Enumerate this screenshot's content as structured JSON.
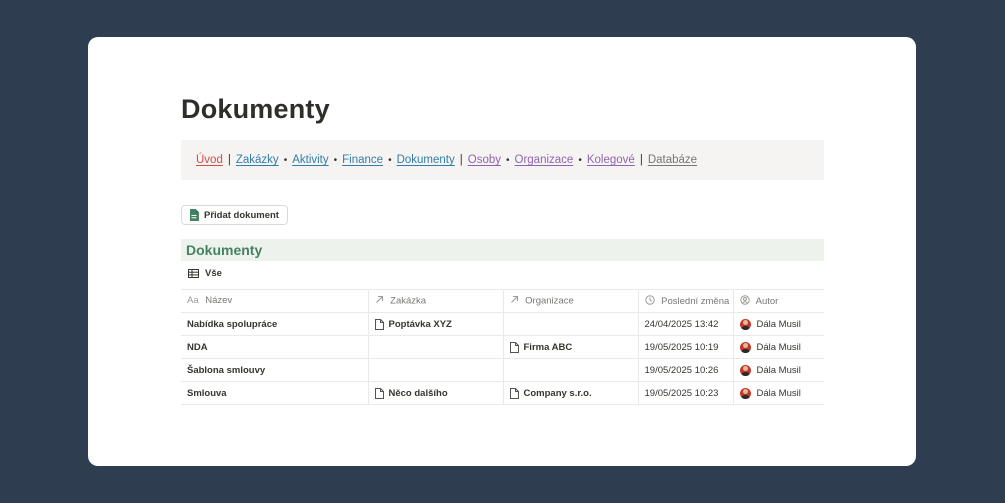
{
  "page": {
    "title": "Dokumenty"
  },
  "nav": {
    "items": [
      {
        "label": "Úvod",
        "color": "#d44c47"
      },
      {
        "sep": "|"
      },
      {
        "label": "Zakázky",
        "color": "#337ea9"
      },
      {
        "sep": "•"
      },
      {
        "label": "Aktivity",
        "color": "#337ea9"
      },
      {
        "sep": "•"
      },
      {
        "label": "Finance",
        "color": "#337ea9"
      },
      {
        "sep": "•"
      },
      {
        "label": "Dokumenty",
        "color": "#337ea9"
      },
      {
        "sep": "|"
      },
      {
        "label": "Osoby",
        "color": "#9065b0"
      },
      {
        "sep": "•"
      },
      {
        "label": "Organizace",
        "color": "#9065b0"
      },
      {
        "sep": "•"
      },
      {
        "label": "Kolegové",
        "color": "#9065b0"
      },
      {
        "sep": "|"
      },
      {
        "label": "Databáze",
        "color": "#787774"
      }
    ]
  },
  "actions": {
    "add_document_label": "Přidat dokument"
  },
  "database": {
    "title": "Dokumenty",
    "view_label": "Vše",
    "columns": [
      {
        "label": "Název",
        "icon": "text-icon",
        "glyph": "Aa"
      },
      {
        "label": "Zakázka",
        "icon": "relation-arrow-icon"
      },
      {
        "label": "Organizace",
        "icon": "relation-arrow-icon"
      },
      {
        "label": "Poslední změna",
        "icon": "clock-icon"
      },
      {
        "label": "Autor",
        "icon": "person-icon"
      }
    ],
    "rows": [
      {
        "name": "Nabídka spolupráce",
        "zakazka": "Poptávka XYZ",
        "organizace": "",
        "modified": "24/04/2025 13:42",
        "author": "Dála Musil"
      },
      {
        "name": "NDA",
        "zakazka": "",
        "organizace": "Firma ABC",
        "modified": "19/05/2025 10:19",
        "author": "Dála Musil"
      },
      {
        "name": "Šablona smlouvy",
        "zakazka": "",
        "organizace": "",
        "modified": "19/05/2025 10:26",
        "author": "Dála Musil"
      },
      {
        "name": "Smlouva",
        "zakazka": "Něco dalšího",
        "organizace": "Company s.r.o.",
        "modified": "19/05/2025 10:23",
        "author": "Dála Musil"
      }
    ]
  },
  "colors": {
    "background": "#2e3d50",
    "accent_green": "#448361",
    "db_header_bg": "#edf3ec",
    "nav_bg": "#f5f4f3"
  }
}
